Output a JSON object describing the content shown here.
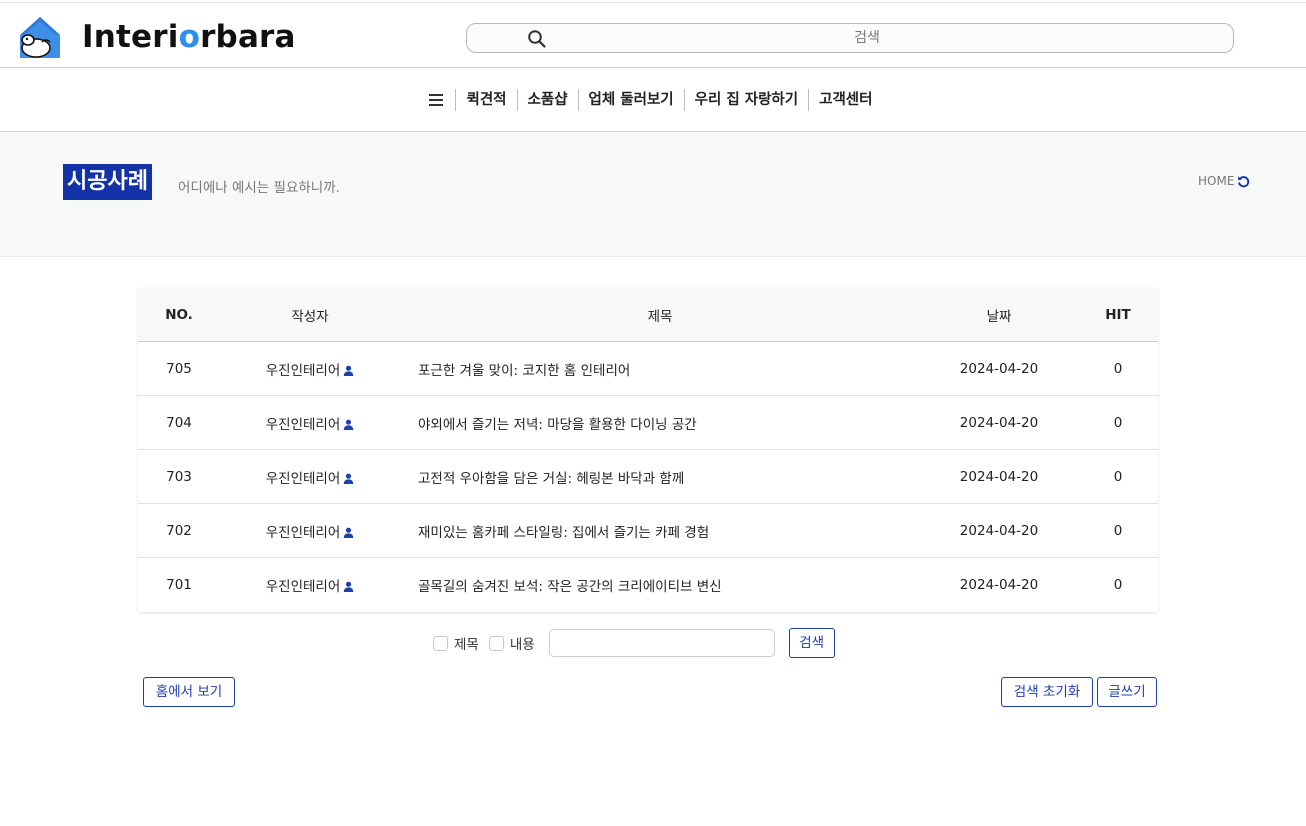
{
  "header": {
    "logo_text_pre": "Interi",
    "logo_text_hl": "o",
    "logo_text_post": "rbara",
    "search_placeholder": "검색"
  },
  "nav": {
    "items": [
      "퀵견적",
      "소품샵",
      "업체 둘러보기",
      "우리 집 자랑하기",
      "고객센터"
    ]
  },
  "page": {
    "title": "시공사례",
    "subtitle": "어디에나 예시는 필요하니까.",
    "home_link": "HOME"
  },
  "table": {
    "headers": {
      "no": "NO.",
      "author": "작성자",
      "title": "제목",
      "date": "날짜",
      "hit": "HIT"
    },
    "rows": [
      {
        "no": "705",
        "author": "우진인테리어",
        "title": "포근한 겨울 맞이: 코지한 홈 인테리어",
        "date": "2024-04-20",
        "hit": "0"
      },
      {
        "no": "704",
        "author": "우진인테리어",
        "title": "야외에서 즐기는 저녁: 마당을 활용한 다이닝 공간",
        "date": "2024-04-20",
        "hit": "0"
      },
      {
        "no": "703",
        "author": "우진인테리어",
        "title": "고전적 우아함을 담은 거실: 헤링본 바닥과 함께",
        "date": "2024-04-20",
        "hit": "0"
      },
      {
        "no": "702",
        "author": "우진인테리어",
        "title": "재미있는 홈카페 스타일링: 집에서 즐기는 카페 경험",
        "date": "2024-04-20",
        "hit": "0"
      },
      {
        "no": "701",
        "author": "우진인테리어",
        "title": "골목길의 숨겨진 보석: 작은 공간의 크리에이티브 변신",
        "date": "2024-04-20",
        "hit": "0"
      }
    ]
  },
  "filter": {
    "title_label": "제목",
    "content_label": "내용",
    "search_value": "",
    "search_button": "검색"
  },
  "actions": {
    "home_view": "홈에서 보기",
    "reset_search": "검색 초기화",
    "write": "글쓰기"
  },
  "colors": {
    "accent": "#1432a8",
    "logo_accent": "#2b8ff0",
    "button_border": "#1e3fb0"
  }
}
